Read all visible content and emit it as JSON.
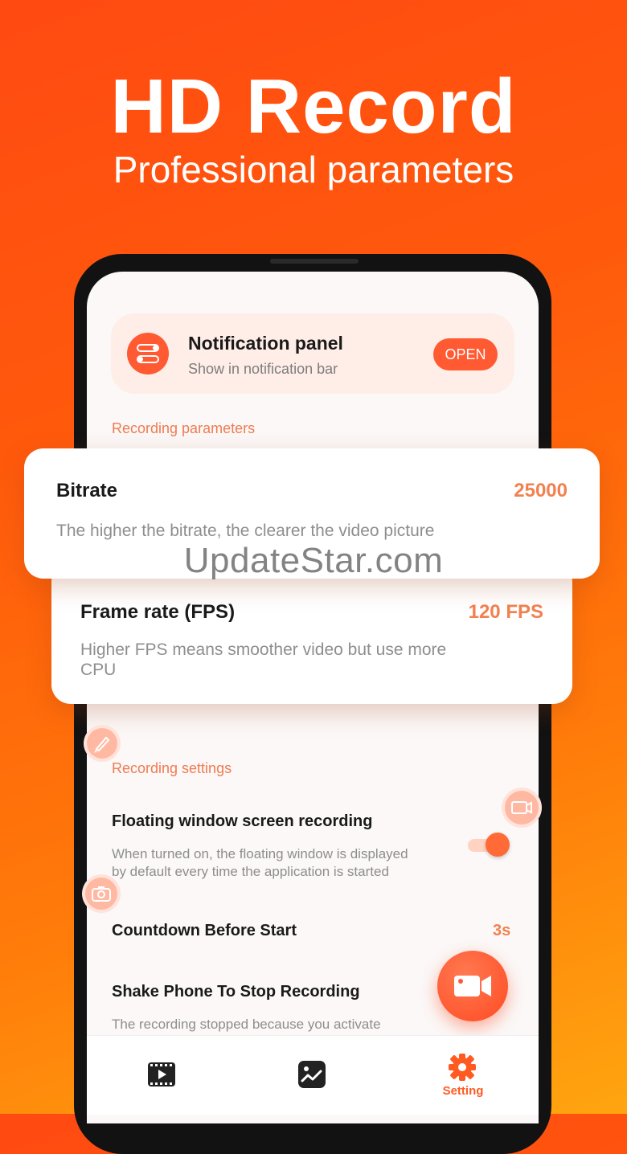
{
  "promo": {
    "headline": "HD Record",
    "subheadline": "Professional parameters"
  },
  "notification_panel": {
    "title": "Notification panel",
    "subtitle": "Show in notification bar",
    "button_label": "OPEN"
  },
  "recording_parameters": {
    "section_label": "Recording parameters",
    "bitrate": {
      "title": "Bitrate",
      "value": "25000",
      "description": "The higher the bitrate, the clearer the video picture"
    },
    "frame_rate": {
      "title": "Frame rate (FPS)",
      "value": "120 FPS",
      "description_line1": "Higher FPS means smoother video but use more",
      "description_line2": "CPU"
    }
  },
  "watermark": "UpdateStar.com",
  "recording_settings": {
    "section_label": "Recording settings",
    "floating_window": {
      "title": "Floating window screen recording",
      "description_line1": "When turned on, the floating window is displayed",
      "description_line2": "by default every time the application is started",
      "enabled": true
    },
    "countdown": {
      "title": "Countdown Before Start",
      "value": "3s"
    },
    "shake": {
      "title": "Shake Phone To Stop Recording",
      "description": "The recording stopped because you activate"
    }
  },
  "bottom_nav": {
    "items": [
      {
        "icon": "video-list-icon"
      },
      {
        "icon": "gallery-icon"
      },
      {
        "icon": "settings-gear-icon",
        "label": "Setting",
        "active": true
      }
    ]
  },
  "colors": {
    "accent": "#ff5a32",
    "value_orange": "#f2814f"
  }
}
